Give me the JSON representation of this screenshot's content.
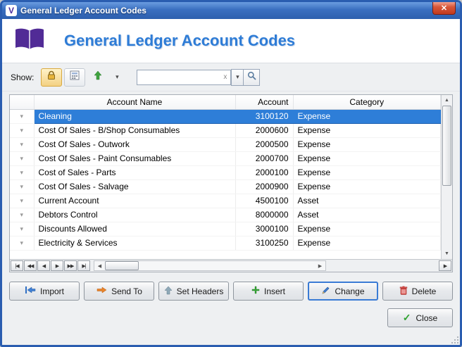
{
  "window": {
    "title": "General Ledger Account Codes"
  },
  "header": {
    "title": "General Ledger Account Codes"
  },
  "toolbar": {
    "show_label": "Show:",
    "search_value": "",
    "search_placeholder": ""
  },
  "table": {
    "columns": [
      "Account Name",
      "Account",
      "Category"
    ],
    "rows": [
      {
        "name": "Cleaning",
        "account": "3100120",
        "category": "Expense",
        "selected": true
      },
      {
        "name": "Cost Of Sales - B/Shop Consumables",
        "account": "2000600",
        "category": "Expense"
      },
      {
        "name": "Cost Of Sales - Outwork",
        "account": "2000500",
        "category": "Expense"
      },
      {
        "name": "Cost Of Sales - Paint Consumables",
        "account": "2000700",
        "category": "Expense"
      },
      {
        "name": "Cost of Sales - Parts",
        "account": "2000100",
        "category": "Expense"
      },
      {
        "name": "Cost Of Sales - Salvage",
        "account": "2000900",
        "category": "Expense"
      },
      {
        "name": "Current Account",
        "account": "4500100",
        "category": "Asset"
      },
      {
        "name": "Debtors Control",
        "account": "8000000",
        "category": "Asset"
      },
      {
        "name": "Discounts Allowed",
        "account": "3000100",
        "category": "Expense"
      },
      {
        "name": "Electricity & Services",
        "account": "3100250",
        "category": "Expense"
      }
    ],
    "nav_buttons": [
      "|◀",
      "◀◀",
      "◀",
      "▶",
      "▶▶",
      "▶|"
    ]
  },
  "actions": {
    "import": "Import",
    "send_to": "Send To",
    "set_headers": "Set Headers",
    "insert": "Insert",
    "change": "Change",
    "delete": "Delete"
  },
  "close_button": {
    "label": "Close"
  },
  "icons": {
    "close": "✕",
    "app_logo": "V",
    "dropdown": "▾",
    "row_expand": "▾",
    "clear": "x",
    "scroll_up": "▲",
    "scroll_down": "▼",
    "scroll_left": "◀",
    "scroll_right": "▶",
    "plus": "+",
    "check": "✓"
  },
  "colors": {
    "accent_blue": "#2e7cd6",
    "selection_blue": "#2e7ed8",
    "titlebar_blue": "#3a6fc0",
    "border_blue": "#2a5db0"
  }
}
